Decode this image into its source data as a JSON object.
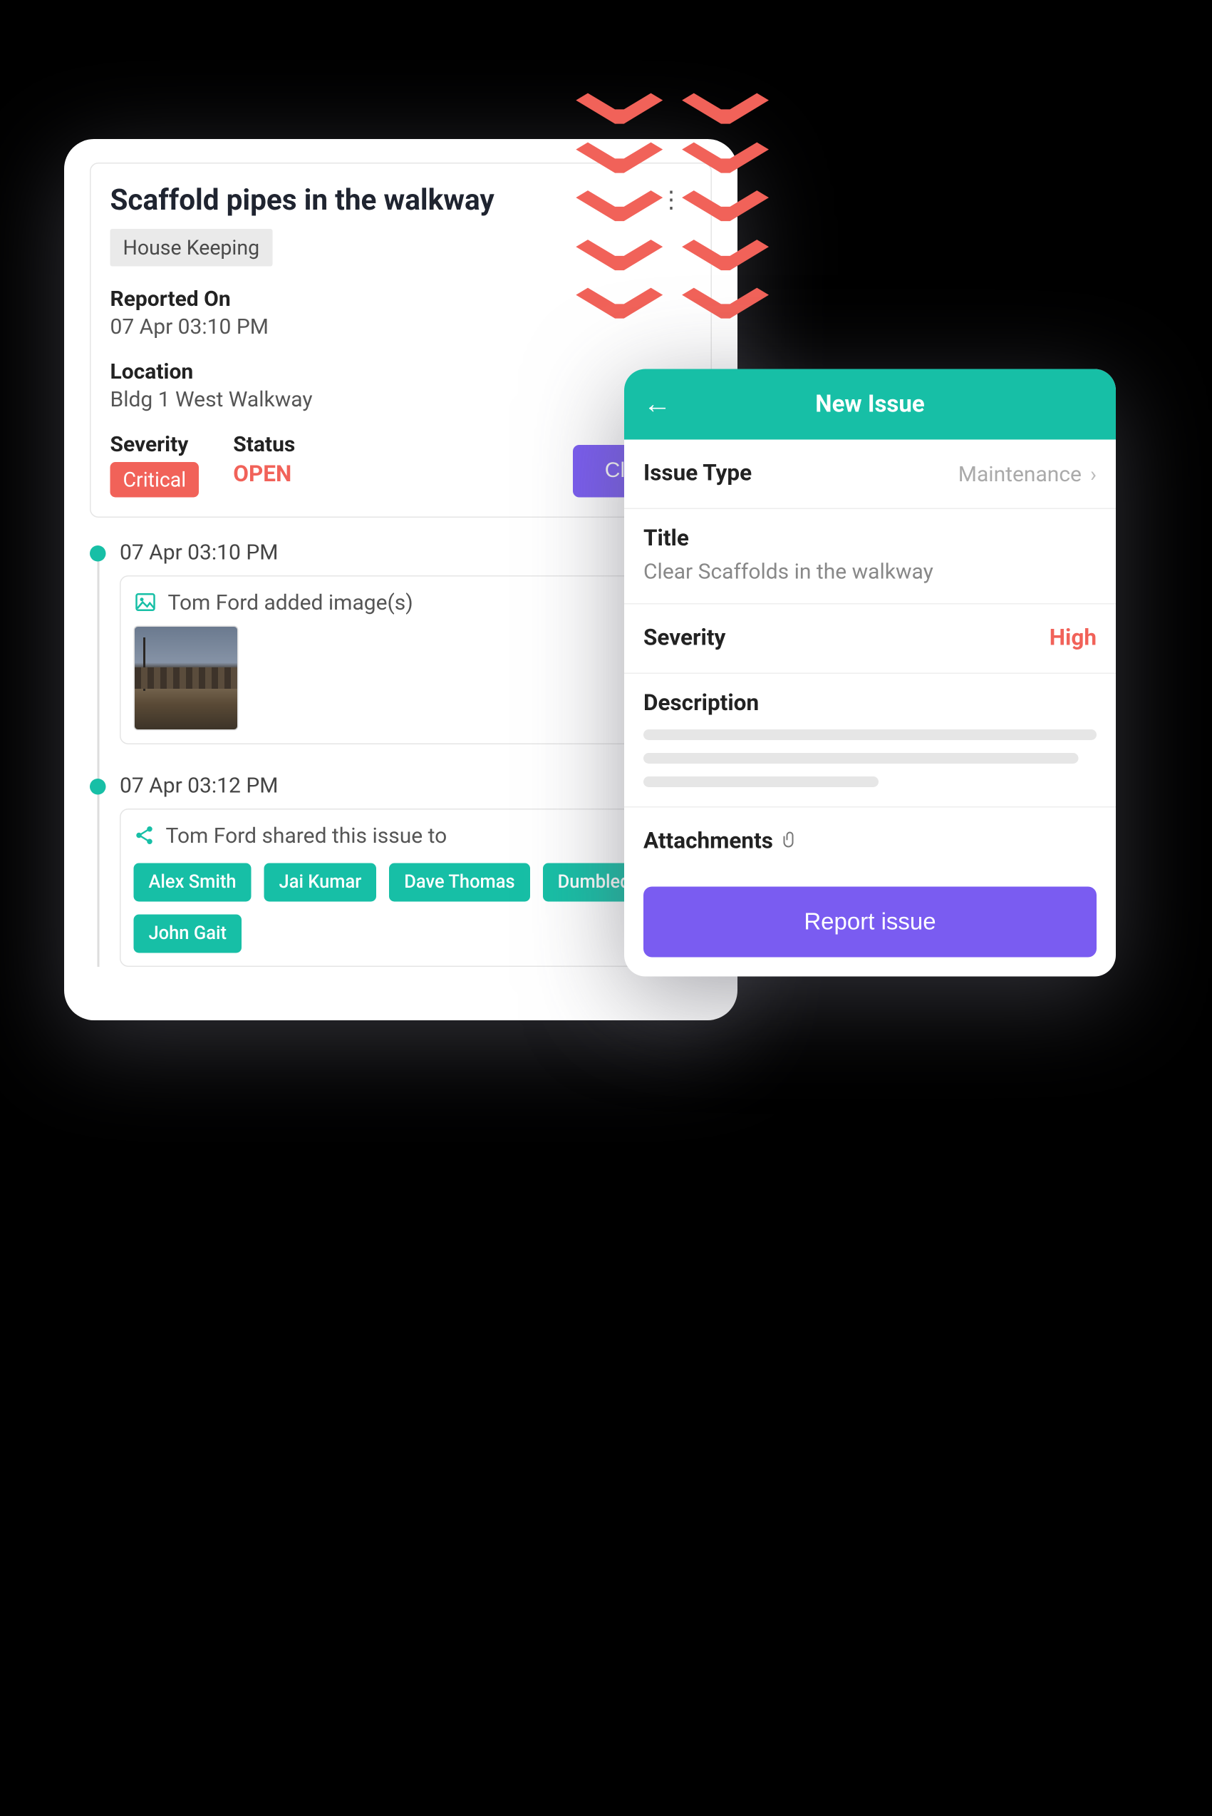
{
  "issue": {
    "title": "Scaffold pipes in the walkway",
    "category": "House Keeping",
    "reported_on_label": "Reported On",
    "reported_on_value": "07 Apr 03:10 PM",
    "location_label": "Location",
    "location_value": "Bldg  1 West Walkway",
    "severity_label": "Severity",
    "severity_value": "Critical",
    "status_label": "Status",
    "status_value": "OPEN",
    "close_button": "Close"
  },
  "timeline": [
    {
      "time": "07 Apr 03:10 PM",
      "type": "image",
      "text": "Tom Ford added image(s)"
    },
    {
      "time": "07 Apr 03:12 PM",
      "type": "share",
      "text": "Tom Ford shared this issue to",
      "people": [
        "Alex Smith",
        "Jai Kumar",
        "Dave Thomas",
        "Dumbledoor",
        "John Gait"
      ]
    }
  ],
  "new_issue": {
    "title": "New Issue",
    "issue_type_label": "Issue Type",
    "issue_type_value": "Maintenance",
    "title_label": "Title",
    "title_value": "Clear Scaffolds in the walkway",
    "severity_label": "Severity",
    "severity_value": "High",
    "description_label": "Description",
    "attachments_label": "Attachments",
    "report_button": "Report issue"
  },
  "colors": {
    "teal": "#17bfa6",
    "coral": "#f16259",
    "purple": "#7a5cf1"
  }
}
